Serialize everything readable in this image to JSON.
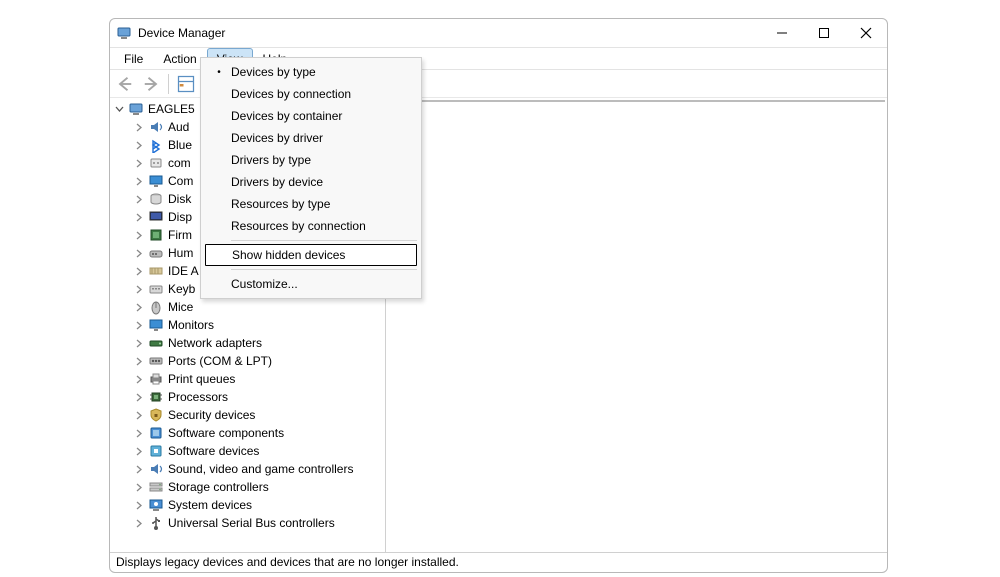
{
  "window": {
    "title": "Device Manager"
  },
  "menubar": {
    "file": "File",
    "action": "Action",
    "view": "View",
    "help": "Help"
  },
  "view_menu": {
    "items": [
      "Devices by type",
      "Devices by connection",
      "Devices by container",
      "Devices by driver",
      "Drivers by type",
      "Drivers by device",
      "Resources by type",
      "Resources by connection"
    ],
    "highlight": "Show hidden devices",
    "customize": "Customize..."
  },
  "tree": {
    "root": "EAGLE5",
    "children": [
      "Aud",
      "Blue",
      "com",
      "Com",
      "Disk",
      "Disp",
      "Firm",
      "Hum",
      "IDE A",
      "Keyb",
      "Mice",
      "Monitors",
      "Network adapters",
      "Ports (COM & LPT)",
      "Print queues",
      "Processors",
      "Security devices",
      "Software components",
      "Software devices",
      "Sound, video and game controllers",
      "Storage controllers",
      "System devices",
      "Universal Serial Bus controllers"
    ]
  },
  "statusbar": "Displays legacy devices and devices that are no longer installed."
}
